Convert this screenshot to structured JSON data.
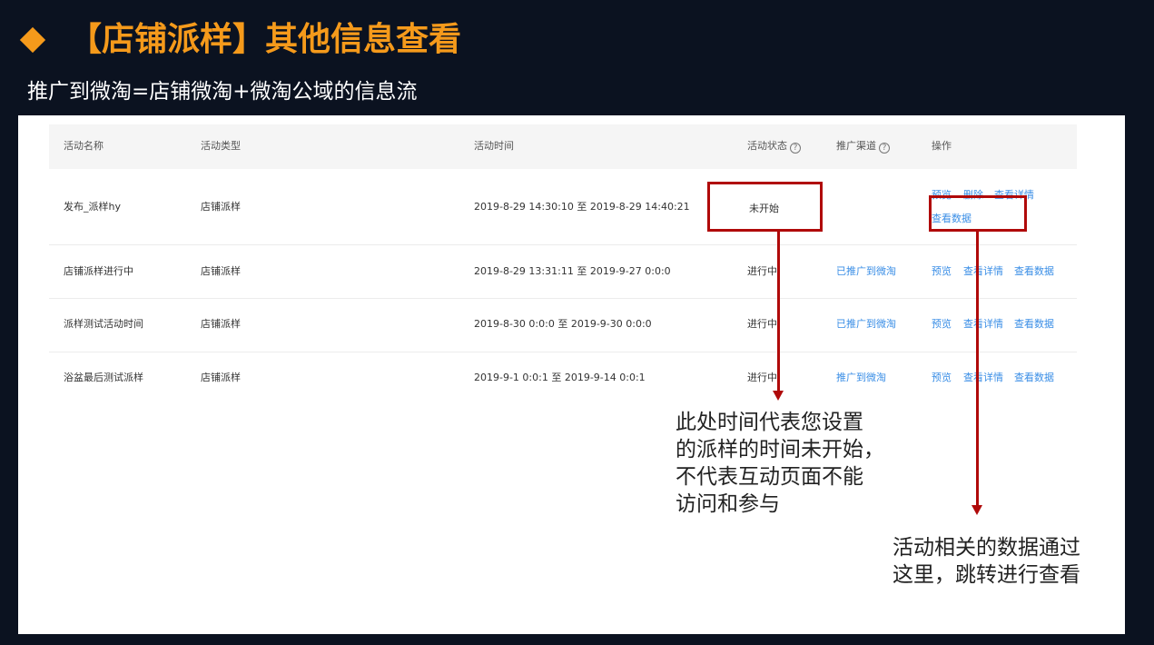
{
  "slide": {
    "title": "【店铺派样】其他信息查看",
    "subtitle": "推广到微淘=店铺微淘+微淘公域的信息流"
  },
  "table": {
    "headers": {
      "name": "活动名称",
      "type": "活动类型",
      "time": "活动时间",
      "status": "活动状态",
      "channel": "推广渠道",
      "actions": "操作"
    },
    "help_glyph": "?",
    "rows": [
      {
        "name": "发布_派样hy",
        "type": "店铺派样",
        "time": "2019-8-29 14:30:10 至 2019-8-29 14:40:21",
        "status": "未开始",
        "channel": "",
        "actions": [
          "预览",
          "删除",
          "查看详情",
          "查看数据"
        ]
      },
      {
        "name": "店铺派样进行中",
        "type": "店铺派样",
        "time": "2019-8-29 13:31:11 至 2019-9-27 0:0:0",
        "status": "进行中",
        "channel": "已推广到微淘",
        "actions": [
          "预览",
          "查看详情",
          "查看数据"
        ]
      },
      {
        "name": "派样测试活动时间",
        "type": "店铺派样",
        "time": "2019-8-30 0:0:0 至 2019-9-30 0:0:0",
        "status": "进行中",
        "channel": "已推广到微淘",
        "actions": [
          "预览",
          "查看详情",
          "查看数据"
        ]
      },
      {
        "name": "浴盆最后测试派样",
        "type": "店铺派样",
        "time": "2019-9-1 0:0:1 至 2019-9-14 0:0:1",
        "status": "进行中",
        "channel": "推广到微淘",
        "actions": [
          "预览",
          "查看详情",
          "查看数据"
        ]
      }
    ]
  },
  "annotations": {
    "status_note": "此处时间代表您设置\n的派样的时间未开始，\n不代表互动页面不能\n访问和参与",
    "data_note": "活动相关的数据通过\n这里，跳转进行查看"
  },
  "colors": {
    "title": "#f59a1b",
    "background": "#0b1220",
    "highlight": "#b00a0a",
    "link": "#3a8ee6"
  }
}
